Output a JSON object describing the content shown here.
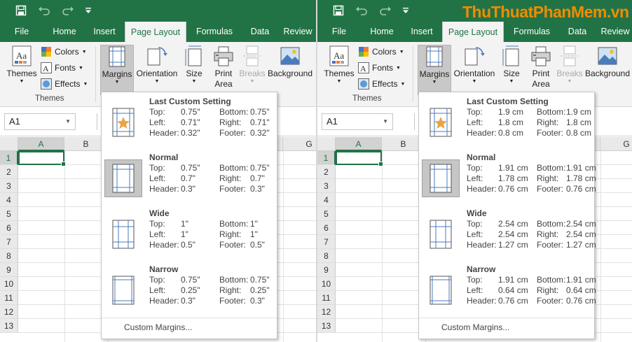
{
  "watermark": "ThuThuatPhanMem.vn",
  "tabs": [
    "File",
    "Home",
    "Insert",
    "Page Layout",
    "Formulas",
    "Data",
    "Review"
  ],
  "ribbon": {
    "themes": "Themes",
    "colors": "Colors",
    "fonts": "Fonts",
    "effects": "Effects",
    "themes_group": "Themes",
    "margins": "Margins",
    "orientation": "Orientation",
    "size": "Size",
    "print_area_1": "Print",
    "print_area_2": "Area",
    "breaks": "Breaks",
    "background": "Background"
  },
  "name_box": "A1",
  "columns": [
    "A",
    "B",
    "G"
  ],
  "rows": [
    "1",
    "2",
    "3",
    "4",
    "5",
    "6",
    "7",
    "8",
    "9",
    "10",
    "11",
    "12",
    "13"
  ],
  "labels": {
    "top": "Top:",
    "bottom": "Bottom:",
    "left": "Left:",
    "right": "Right:",
    "header": "Header:",
    "footer": "Footer:"
  },
  "custom_margins": "Custom Margins...",
  "panels": [
    {
      "options": [
        {
          "name": "Last Custom Setting",
          "icon": "star-page-icon",
          "top": "0.75\"",
          "bottom": "0.75\"",
          "left": "0.71\"",
          "right": "0.71\"",
          "header": "0.32\"",
          "footer": "0.32\""
        },
        {
          "name": "Normal",
          "icon": "normal-margins-icon",
          "top": "0.75\"",
          "bottom": "0.75\"",
          "left": "0.7\"",
          "right": "0.7\"",
          "header": "0.3\"",
          "footer": "0.3\""
        },
        {
          "name": "Wide",
          "icon": "wide-margins-icon",
          "top": "1\"",
          "bottom": "1\"",
          "left": "1\"",
          "right": "1\"",
          "header": "0.5\"",
          "footer": "0.5\""
        },
        {
          "name": "Narrow",
          "icon": "narrow-margins-icon",
          "top": "0.75\"",
          "bottom": "0.75\"",
          "left": "0.25\"",
          "right": "0.25\"",
          "header": "0.3\"",
          "footer": "0.3\""
        }
      ]
    },
    {
      "options": [
        {
          "name": "Last Custom Setting",
          "icon": "star-page-icon",
          "top": "1.9 cm",
          "bottom": "1.9 cm",
          "left": "1.8 cm",
          "right": "1.8 cm",
          "header": "0.8 cm",
          "footer": "0.8 cm"
        },
        {
          "name": "Normal",
          "icon": "normal-margins-icon",
          "top": "1.91 cm",
          "bottom": "1.91 cm",
          "left": "1.78 cm",
          "right": "1.78 cm",
          "header": "0.76 cm",
          "footer": "0.76 cm"
        },
        {
          "name": "Wide",
          "icon": "wide-margins-icon",
          "top": "2.54 cm",
          "bottom": "2.54 cm",
          "left": "2.54 cm",
          "right": "2.54 cm",
          "header": "1.27 cm",
          "footer": "1.27 cm"
        },
        {
          "name": "Narrow",
          "icon": "narrow-margins-icon",
          "top": "1.91 cm",
          "bottom": "1.91 cm",
          "left": "0.64 cm",
          "right": "0.64 cm",
          "header": "0.76 cm",
          "footer": "0.76 cm"
        }
      ]
    }
  ],
  "colors": {
    "excel_green": "#217346",
    "ribbon_bg": "#f3f3f3",
    "watermark": "#f08c00"
  }
}
